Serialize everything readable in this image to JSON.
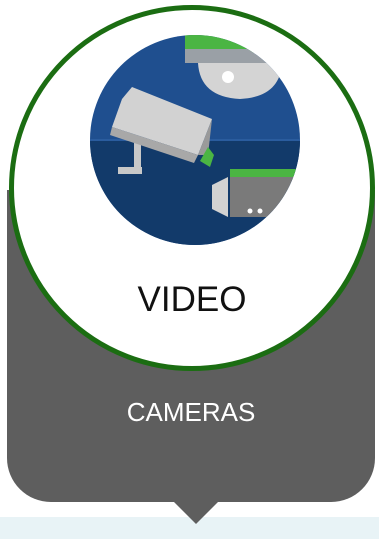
{
  "tile": {
    "title": "VIDEO",
    "subtitle": "CAMERAS",
    "icon": "security-cameras-icon",
    "colors": {
      "ring": "#1b6d12",
      "body": "#5e5e5e",
      "icon_background": "#1f4f8f",
      "icon_floor": "#123a6a",
      "accent": "#4bb543",
      "camera_grey": "#c8c8c8",
      "strip": "#e8f3f6"
    }
  }
}
